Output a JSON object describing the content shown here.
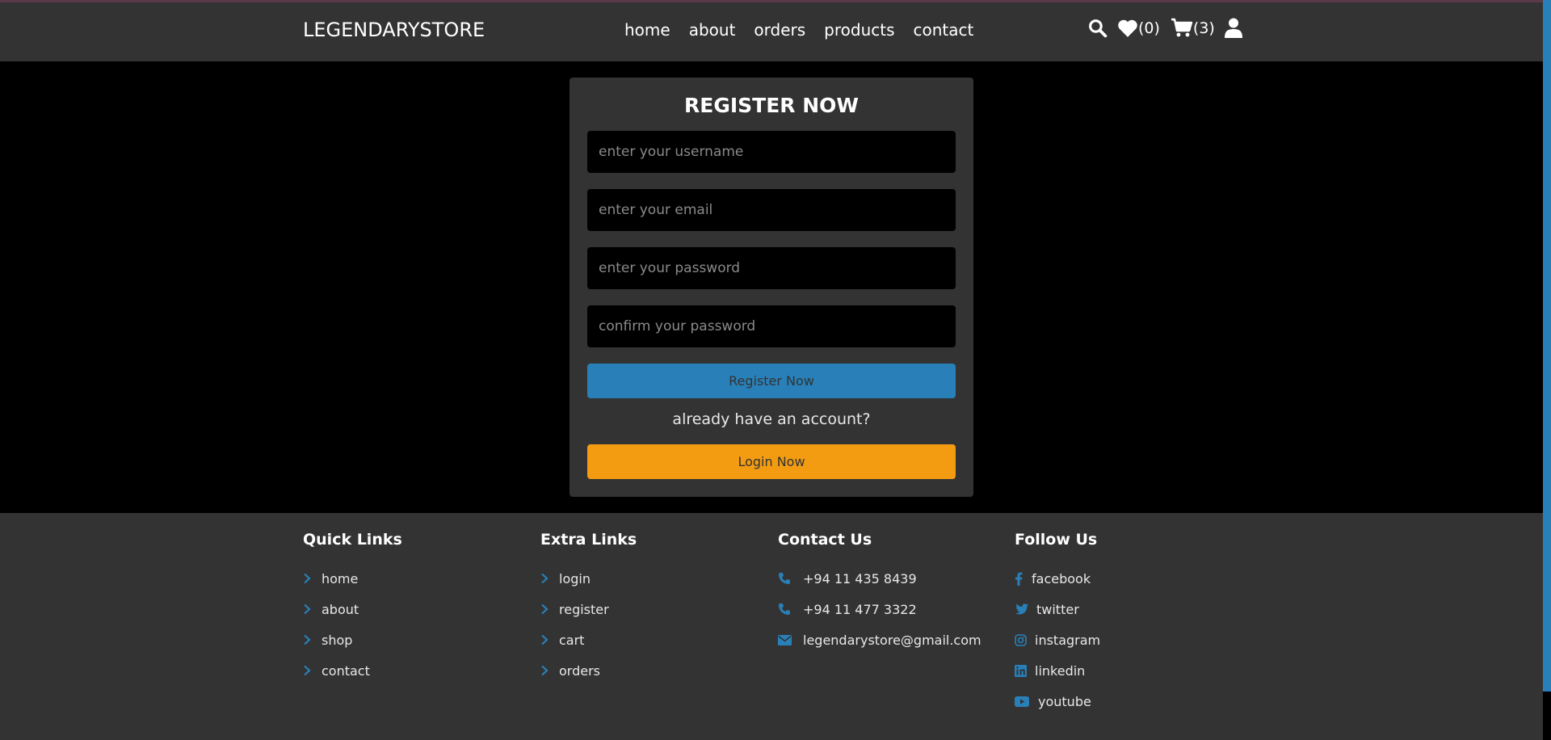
{
  "header": {
    "logo": "LEGENDARYSTORE",
    "nav": [
      "home",
      "about",
      "orders",
      "products",
      "contact"
    ],
    "wishlist_count": "(0)",
    "cart_count": "(3)"
  },
  "form": {
    "title": "REGISTER NOW",
    "username_placeholder": "enter your username",
    "email_placeholder": "enter your email",
    "password_placeholder": "enter your password",
    "confirm_placeholder": "confirm your password",
    "register_label": "Register Now",
    "already_text": "already have an account?",
    "login_label": "Login Now"
  },
  "footer": {
    "quick": {
      "title": "Quick Links",
      "items": [
        "home",
        "about",
        "shop",
        "contact"
      ]
    },
    "extra": {
      "title": "Extra Links",
      "items": [
        "login",
        "register",
        "cart",
        "orders"
      ]
    },
    "contact": {
      "title": "Contact Us",
      "items": [
        "+94 11 435 8439",
        "+94 11 477 3322",
        "legendarystore@gmail.com"
      ]
    },
    "follow": {
      "title": "Follow Us",
      "items": [
        "facebook",
        "twitter",
        "instagram",
        "linkedin",
        "youtube"
      ]
    }
  },
  "colors": {
    "accent": "#2980b9",
    "orange": "#f39c12",
    "panel": "#333333",
    "bg": "#000000"
  }
}
